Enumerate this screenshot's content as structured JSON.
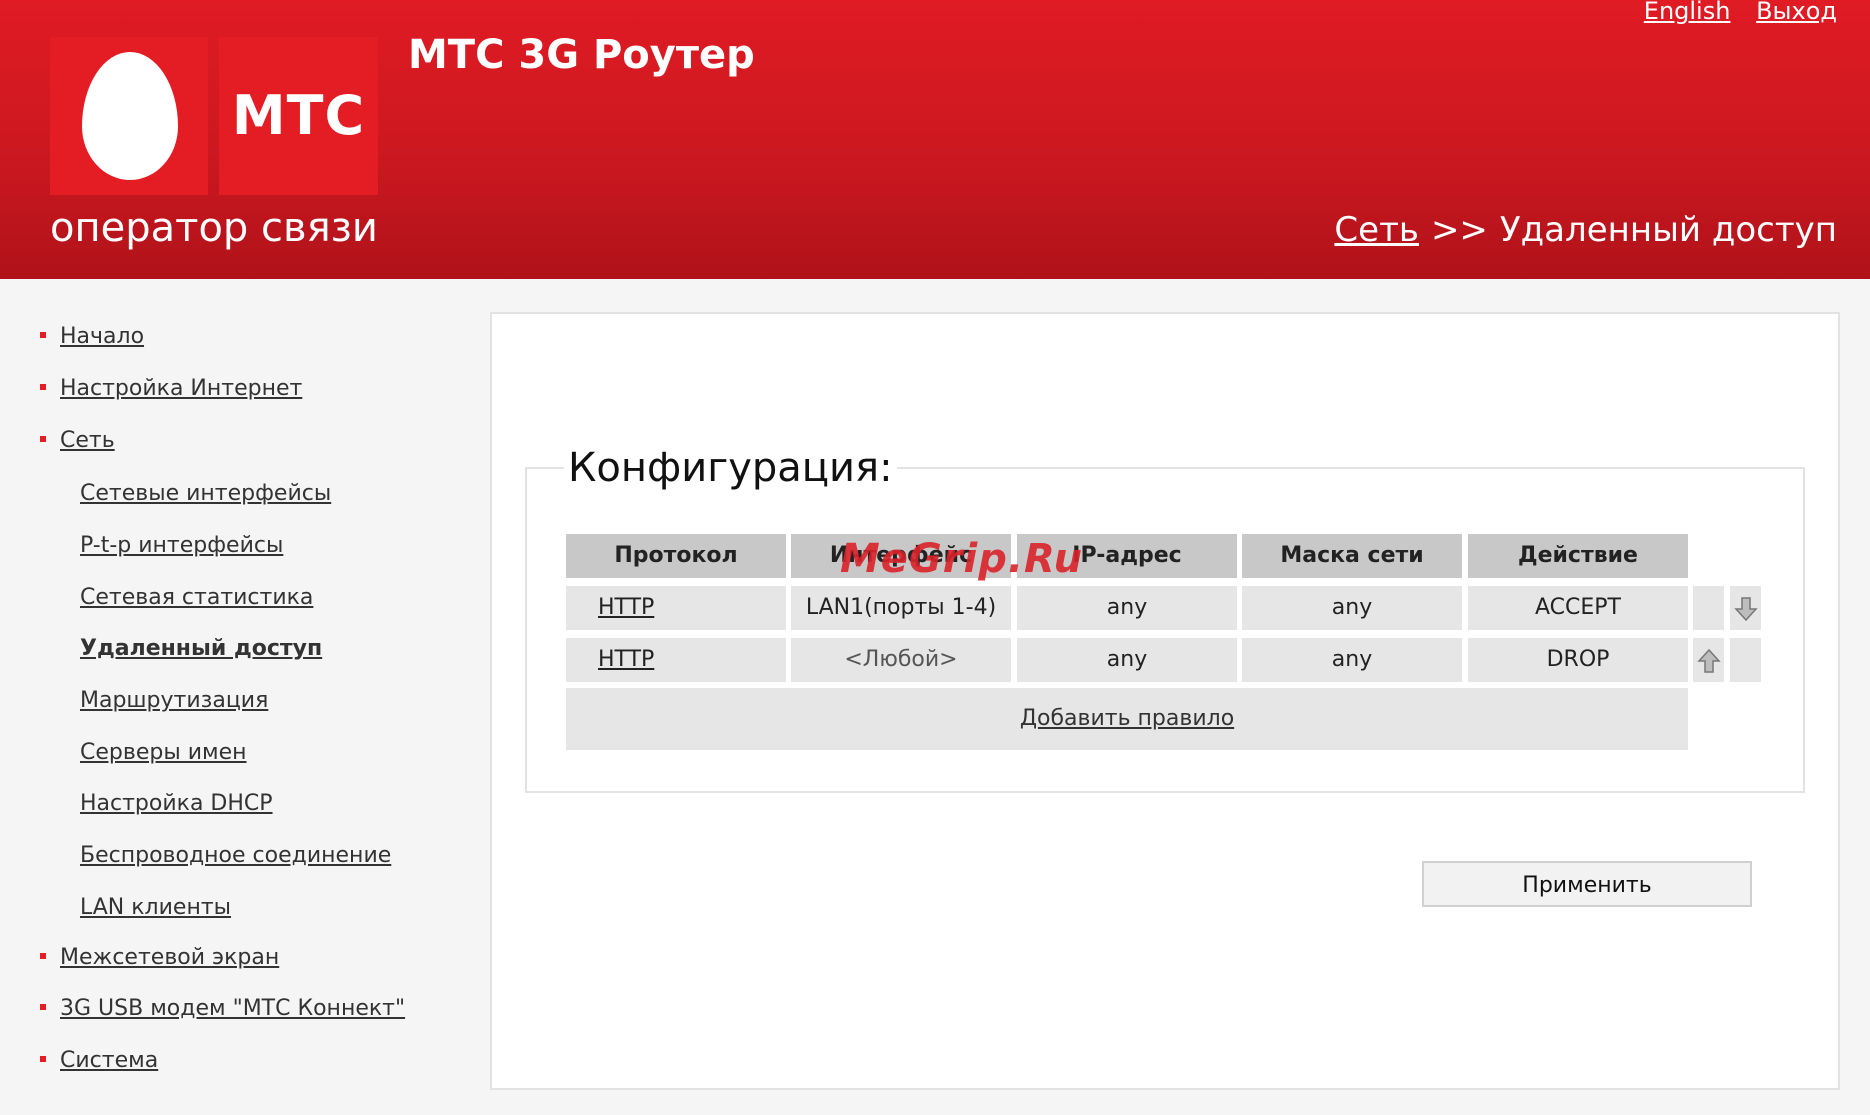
{
  "header": {
    "logo_text": "МТС",
    "slogan": "оператор связи",
    "title": "МТС 3G Роутер",
    "links": {
      "english": "English",
      "logout": "Выход"
    },
    "breadcrumb": {
      "parent": "Сеть",
      "separator": ">>",
      "current": "Удаленный доступ"
    }
  },
  "sidebar": {
    "items": [
      {
        "label": "Начало",
        "level": 1
      },
      {
        "label": "Настройка Интернет",
        "level": 1
      },
      {
        "label": "Сеть",
        "level": 1
      },
      {
        "label": "Сетевые интерфейсы",
        "level": 2
      },
      {
        "label": "P-t-p интерфейсы",
        "level": 2
      },
      {
        "label": "Сетевая статистика",
        "level": 2
      },
      {
        "label": "Удаленный доступ",
        "level": 2,
        "active": true
      },
      {
        "label": "Маршрутизация",
        "level": 2
      },
      {
        "label": "Серверы имен",
        "level": 2
      },
      {
        "label": "Настройка DHCP",
        "level": 2
      },
      {
        "label": "Беспроводное соединение",
        "level": 2
      },
      {
        "label": "LAN клиенты",
        "level": 2
      },
      {
        "label": "Межсетевой экран",
        "level": 1
      },
      {
        "label": "3G USB модем \"МТС Коннект\"",
        "level": 1
      },
      {
        "label": "Система",
        "level": 1
      }
    ]
  },
  "config": {
    "legend": "Конфигурация:",
    "columns": [
      "Протокол",
      "Интерфейс",
      "IP-адрес",
      "Маска сети",
      "Действие"
    ],
    "rows": [
      {
        "protocol": "HTTP",
        "interface": "LAN1(порты 1-4)",
        "ip": "any",
        "mask": "any",
        "action": "ACCEPT"
      },
      {
        "protocol": "HTTP",
        "interface": "<Любой>",
        "ip": "any",
        "mask": "any",
        "action": "DROP"
      }
    ],
    "add_rule": "Добавить правило",
    "apply": "Применить"
  },
  "watermark": "MeGrip.Ru",
  "colors": {
    "brand_red": "#e41c23",
    "header_dark": "#b0121a"
  },
  "icons": {
    "move_down": "arrow-down-icon",
    "move_up": "arrow-up-icon"
  }
}
